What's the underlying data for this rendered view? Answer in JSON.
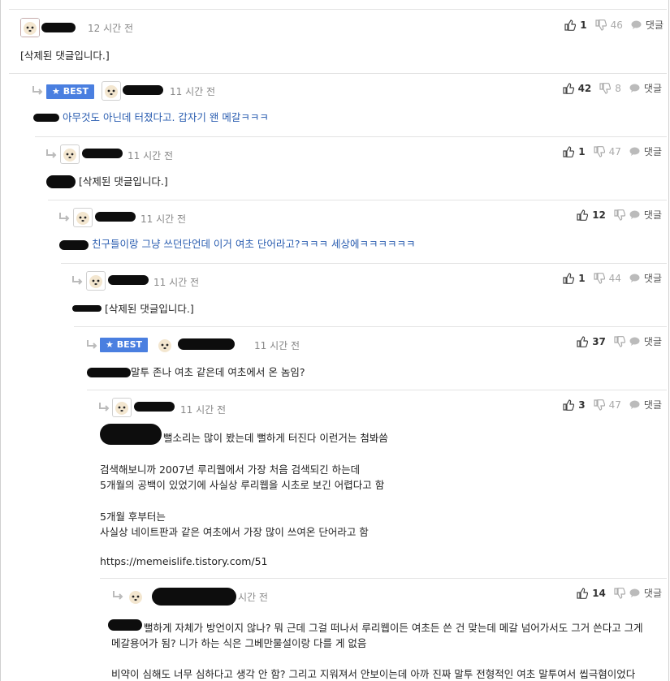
{
  "labels": {
    "best": "BEST",
    "reply": "댓글"
  },
  "colors": {
    "best_bg": "#4a7fe0",
    "link_text": "#2a5db0"
  },
  "comments": [
    {
      "time": "12 시간 전",
      "up": "1",
      "down": "46",
      "text": "[삭제된 댓글입니다.]"
    },
    {
      "time": "11 시간 전",
      "up": "42",
      "down": "8",
      "text": "아무것도 아닌데 터졌다고. 갑자기 왠 메갈ㅋㅋㅋ"
    },
    {
      "time": "11 시간 전",
      "up": "1",
      "down": "47",
      "text": "[삭제된 댓글입니다.]"
    },
    {
      "time": "11 시간 전",
      "up": "12",
      "down": "",
      "text": "친구들이랑 그냥 쓰던단언데 이거 여초 단어라고?ㅋㅋㅋ 세상에ㅋㅋㅋㅋㅋㅋ"
    },
    {
      "time": "11 시간 전",
      "up": "1",
      "down": "44",
      "text": "[삭제된 댓글입니다.]"
    },
    {
      "time": "11 시간 전",
      "up": "37",
      "down": "",
      "text": "말투 존나 여초 같은데 여초에서 온 놈임?"
    },
    {
      "time": "11 시간 전",
      "up": "3",
      "down": "47",
      "lines": [
        "뻘소리는 많이 봤는데 뻘하게 터진다 이런거는 첨봐씀",
        "검색해보니까 2007년 루리웹에서 가장 처음 검색되긴 하는데",
        "5개월의 공백이 있었기에 사실상 루리웹을 시초로 보긴 어렵다고 함",
        "5개월 후부터는",
        "사실상 네이트판과 같은 여초에서 가장 많이 쓰여온 단어라고 함",
        "https://memeislife.tistory.com/51"
      ]
    },
    {
      "time": "시간 전",
      "up": "14",
      "down": "",
      "lines": [
        "뻘하게 자체가 방언이지 않나? 뭐 근데 그걸 떠나서 루리웹이든 여초든 쓴 건 맞는데 메갈 넘어가서도 그거 쓴다고 그게",
        "메갈용어가 됨? 니가 하는 식은 그베만물설이랑 다를 게 없음",
        "비약이 심해도 너무 심하다고 생각 안 함? 그리고 지워져서 안보이는데 아까 진짜 말투 전형적인 여초 말투여서 씹극혐이었다"
      ]
    }
  ]
}
